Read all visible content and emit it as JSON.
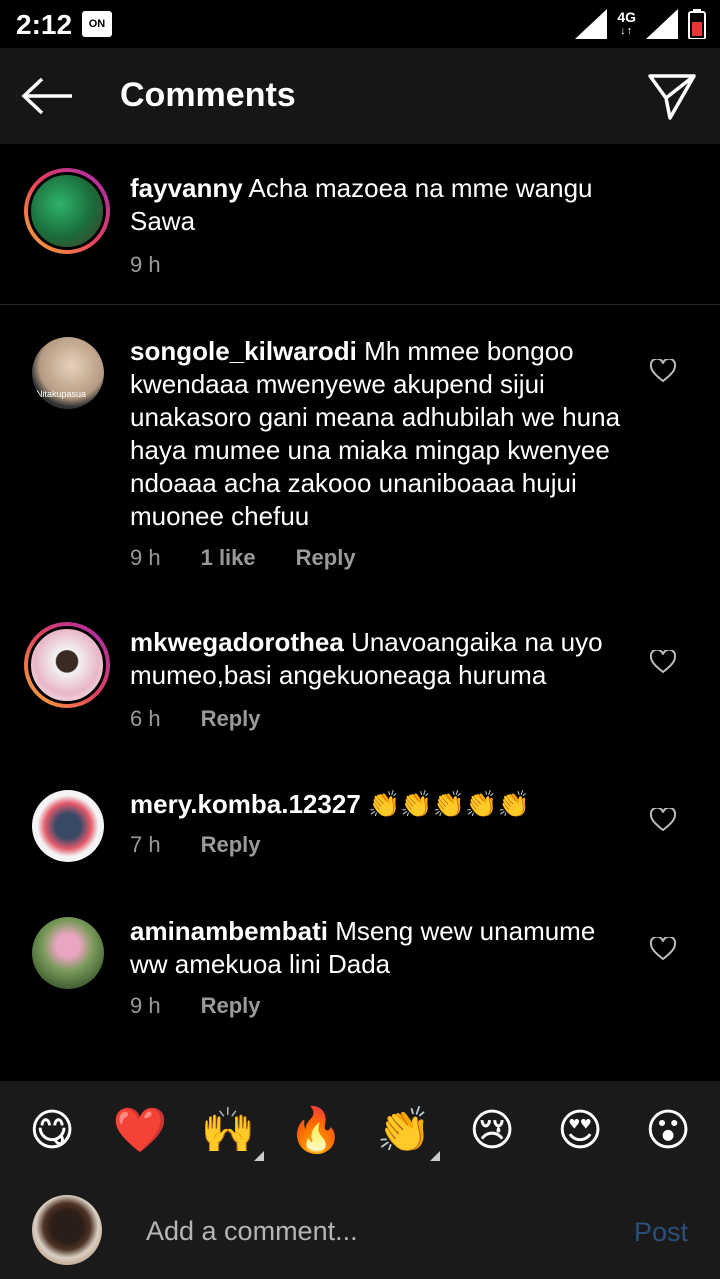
{
  "status_bar": {
    "time": "2:12",
    "on_badge": "ON",
    "network": "4G"
  },
  "header": {
    "title": "Comments"
  },
  "comments": [
    {
      "username": "fayvanny",
      "text": "Acha mazoea na mme wangu Sawa",
      "time": "9 h"
    },
    {
      "username": "songole_kilwarodi",
      "text": "Mh mmee  bongoo kwendaaa mwenyewe akupend sijui unakasoro gani meana adhubilah we huna haya mumee una miaka mingap kwenyee ndoaaa acha zakooo unaniboaaa hujui muonee chefuu",
      "time": "9 h",
      "likes": "1 like",
      "reply": "Reply",
      "avatar_text": "Nitakupasua"
    },
    {
      "username": "mkwegadorothea",
      "text": "Unavoangaika na uyo mumeo,basi angekuoneaga huruma",
      "time": "6 h",
      "reply": "Reply"
    },
    {
      "username": "mery.komba.12327",
      "text": "👏👏👏👏👏",
      "time": "7 h",
      "reply": "Reply"
    },
    {
      "username": "aminambembati",
      "text": "Mseng  wew unamume  ww  amekuoa  lini  Dada",
      "time": "9 h",
      "reply": "Reply"
    }
  ],
  "emoji_bar": [
    "😋",
    "❤️",
    "🙌",
    "🔥",
    "👏",
    "😢",
    "😍",
    "😮"
  ],
  "input": {
    "placeholder": "Add a comment...",
    "post_label": "Post"
  },
  "colors": {
    "background": "#000000",
    "header": "#161616",
    "muted": "#9a9a9a",
    "post_disabled": "#2c4f7a"
  }
}
